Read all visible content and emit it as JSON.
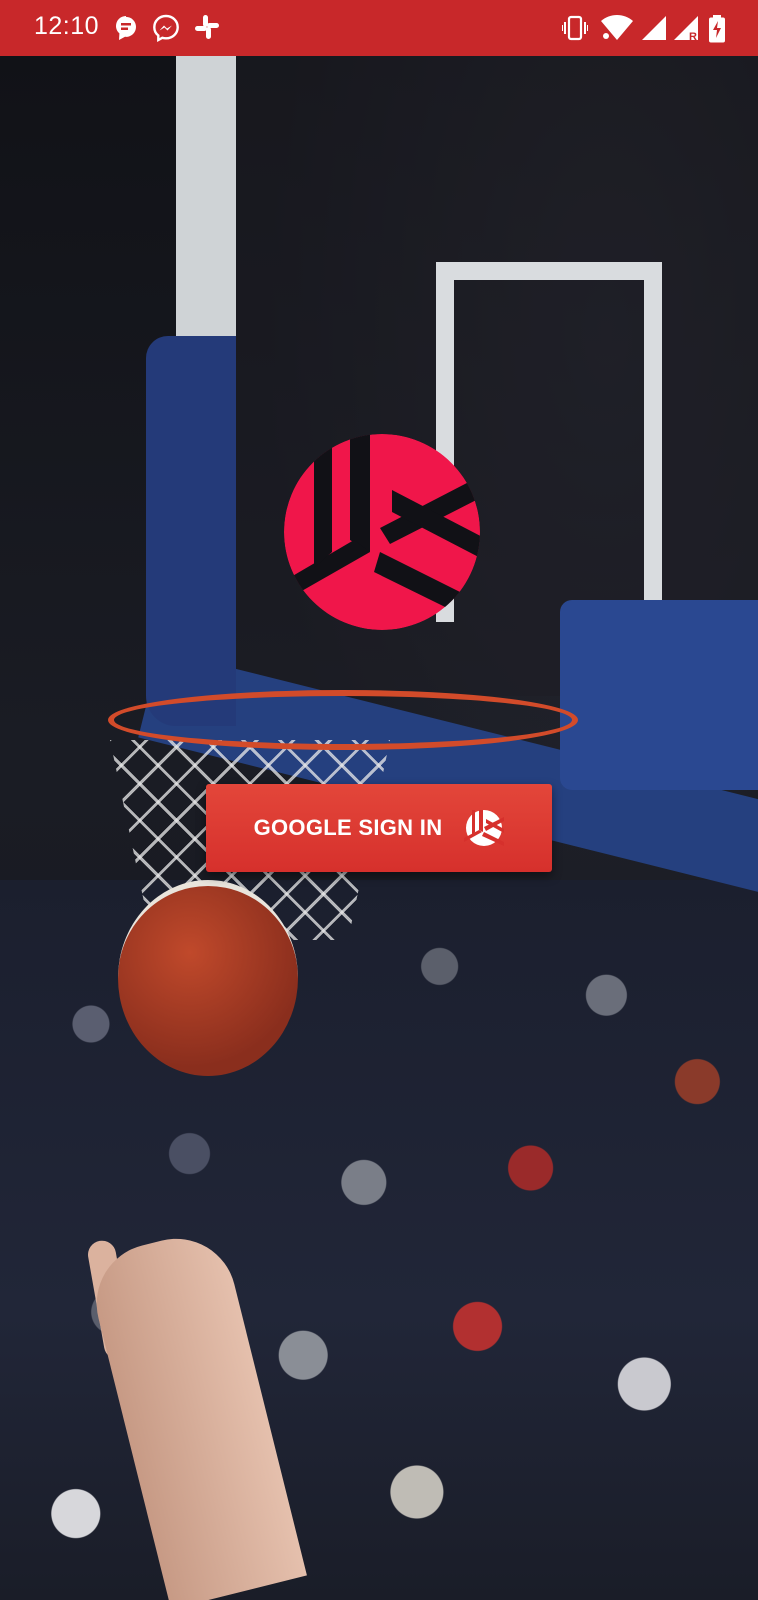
{
  "status_bar": {
    "time": "12:10",
    "left_icons": [
      "sms-message-icon",
      "messenger-icon",
      "slack-icon"
    ],
    "right_icons": [
      "vibrate-icon",
      "wifi-icon",
      "signal-icon",
      "signal-roaming-icon",
      "battery-charging-icon"
    ],
    "roaming_letter": "R",
    "background_color": "#c8282a"
  },
  "logo": {
    "name": "app-logo",
    "color": "#f0164a"
  },
  "signin_button": {
    "label": "GOOGLE SIGN IN",
    "icon": "volleyball-icon",
    "color": "#d6302c"
  }
}
